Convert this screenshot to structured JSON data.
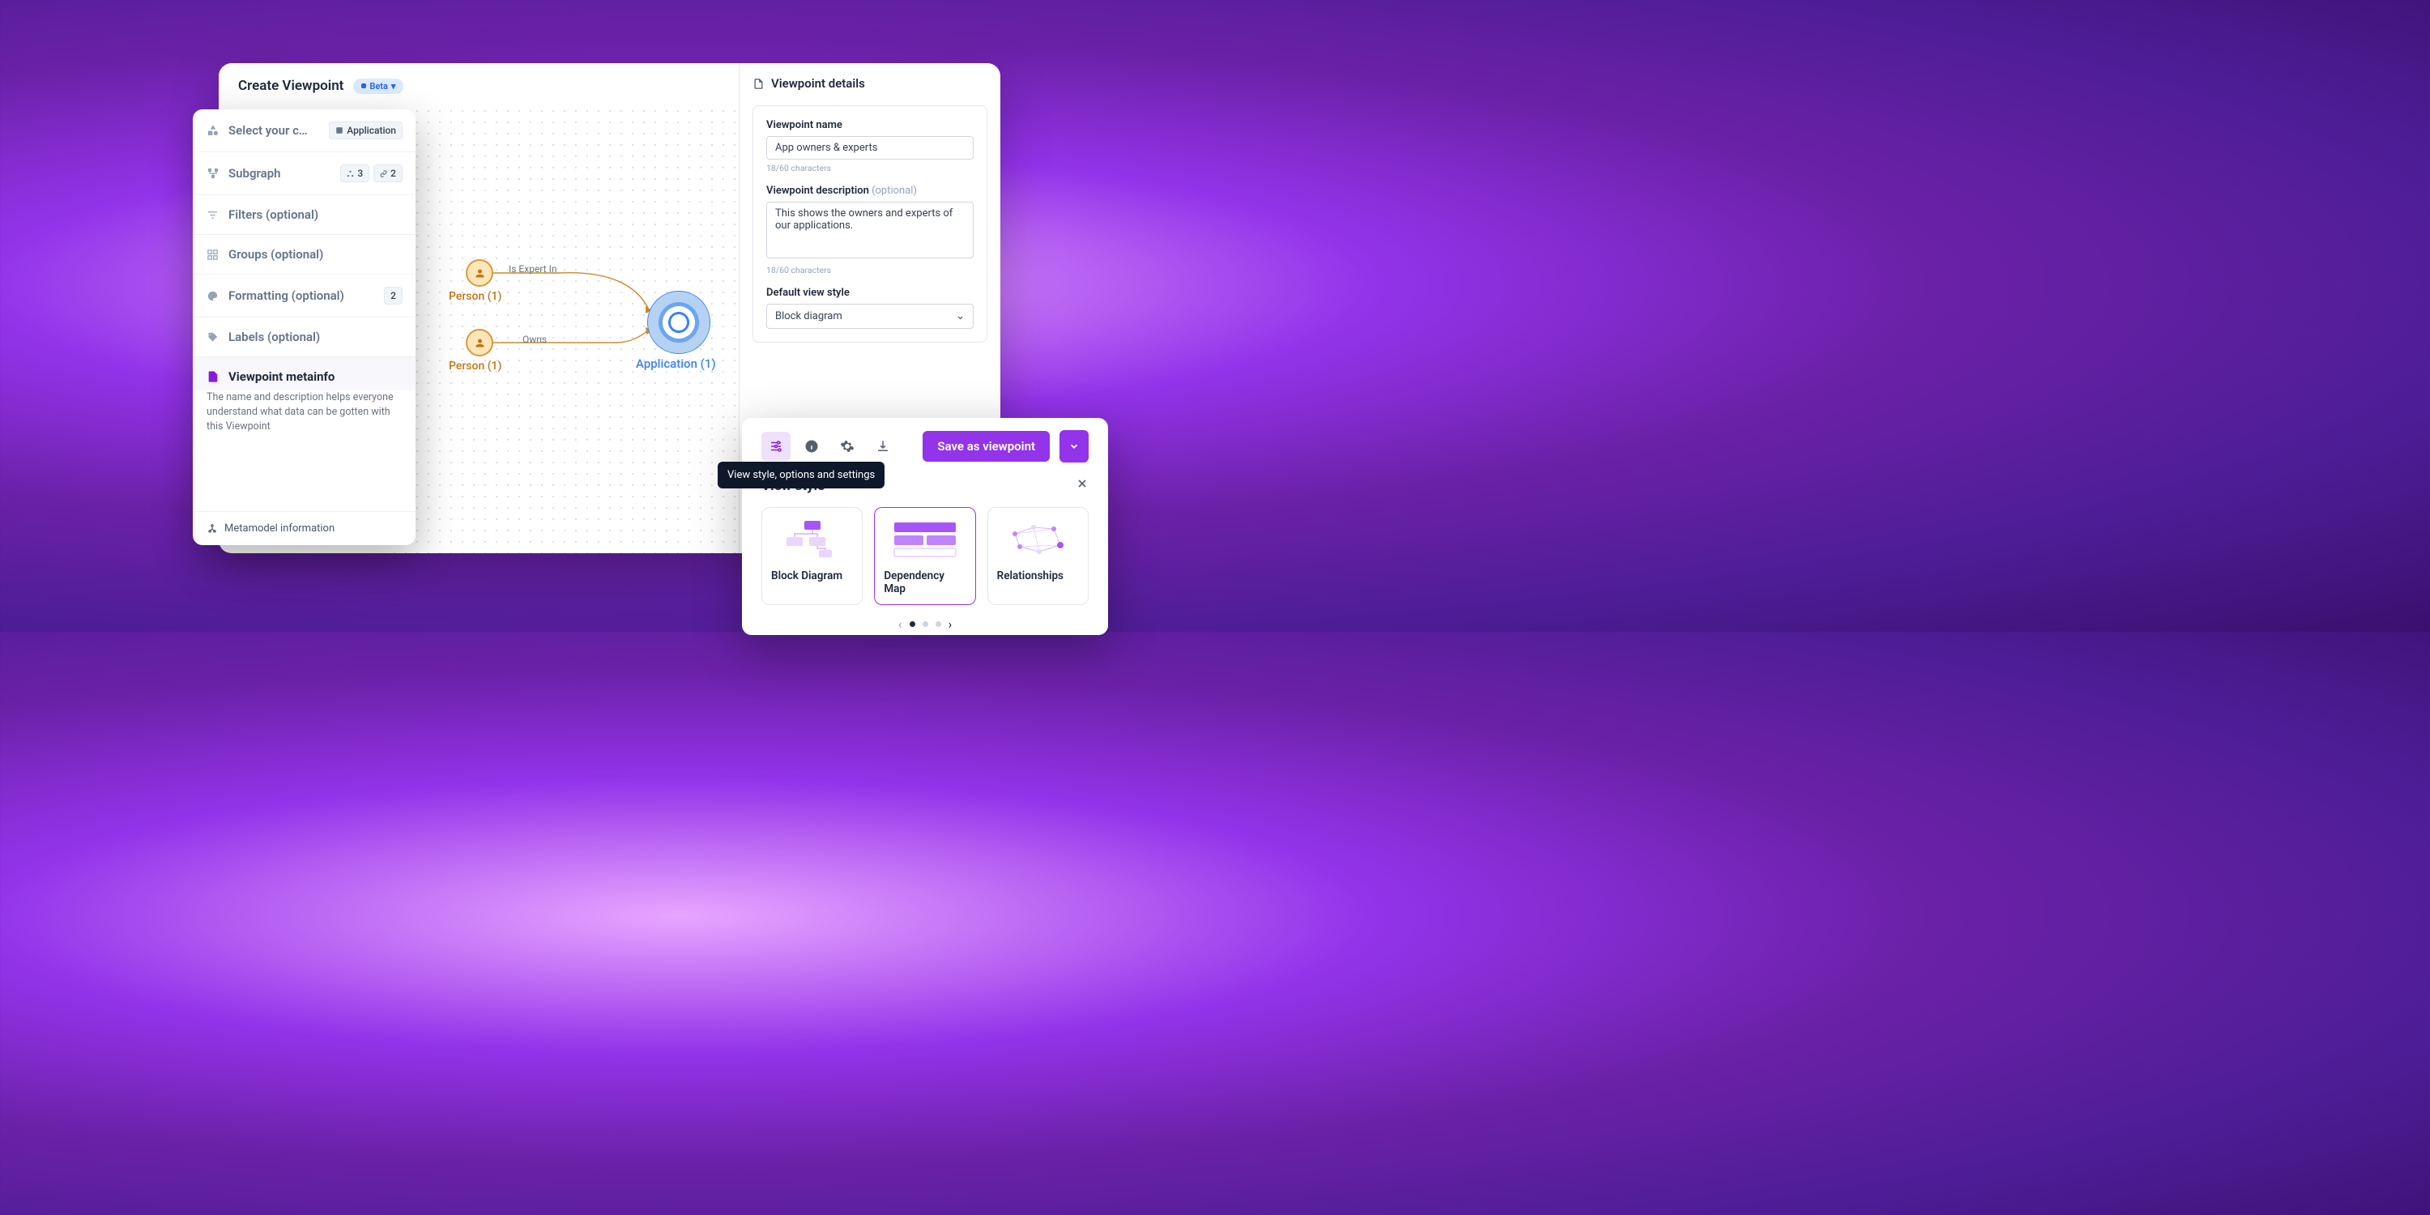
{
  "header": {
    "title": "Create Viewpoint",
    "badge": "Beta"
  },
  "sidebar": {
    "items": [
      {
        "label": "Select your c…",
        "chip": "Application"
      },
      {
        "label": "Subgraph",
        "count_nodes": "3",
        "count_links": "2"
      },
      {
        "label": "Filters (optional)"
      },
      {
        "label": "Groups (optional)"
      },
      {
        "label": "Formatting (optional)",
        "badge": "2"
      },
      {
        "label": "Labels (optional)"
      },
      {
        "label": "Viewpoint metainfo",
        "desc": "The name and description helps everyone understand what data can be gotten with this Viewpoint"
      }
    ],
    "footer": "Metamodel information"
  },
  "graph": {
    "person1": "Person (1)",
    "person2": "Person (1)",
    "app": "Application (1)",
    "rel1": "Is Expert In",
    "rel2": "Owns"
  },
  "details": {
    "title": "Viewpoint details",
    "name_label": "Viewpoint name",
    "name_value": "App owners & experts",
    "name_count": "18/60 characters",
    "desc_label": "Viewpoint description",
    "desc_opt": "(optional)",
    "desc_value": "This shows the owners and experts of our applications.",
    "desc_count": "18/60 characters",
    "style_label": "Default view style",
    "style_value": "Block diagram"
  },
  "toolbar": {
    "tooltip": "View style, options and settings",
    "save": "Save as viewpoint"
  },
  "viewstyle": {
    "title": "View style",
    "cards": [
      "Block Diagram",
      "Dependency Map",
      "Relationships"
    ]
  }
}
